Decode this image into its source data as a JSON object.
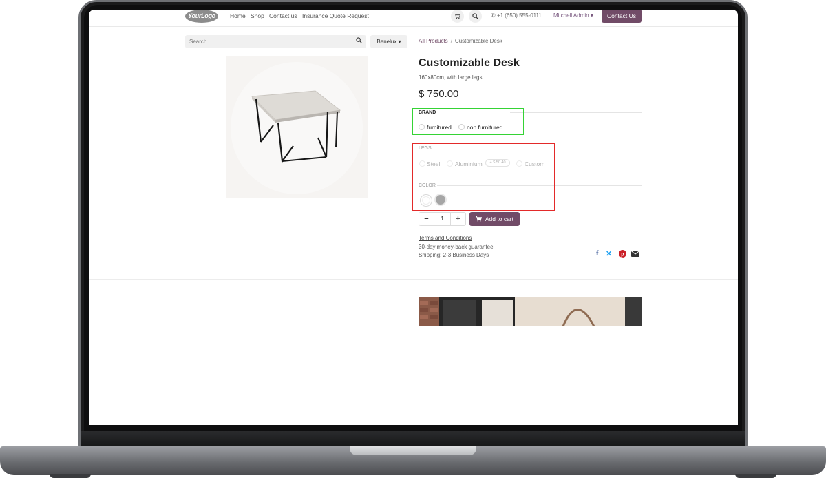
{
  "nav": {
    "logo_text": "YourLogo",
    "links": [
      "Home",
      "Shop",
      "Contact us",
      "Insurance Quote Request"
    ],
    "cart_icon": "cart-icon",
    "search_icon": "search-icon",
    "phone": "+1 (650) 555-0111",
    "user": "Mitchell Admin",
    "contact_button": "Contact Us"
  },
  "search": {
    "placeholder": "Search...",
    "region": "Benelux"
  },
  "breadcrumb": {
    "parent": "All Products",
    "separator": "/",
    "current": "Customizable Desk"
  },
  "product": {
    "name": "Customizable Desk",
    "description": "160x80cm, with large legs.",
    "price": "$ 750.00",
    "attributes": {
      "brand": {
        "label": "BRAND",
        "options": [
          "furnitured",
          "non furnitured"
        ]
      },
      "legs": {
        "label": "LEGS",
        "options": [
          "Steel",
          "Aluminium",
          "Custom"
        ],
        "aluminium_extra": "+ $ 50.40"
      },
      "color": {
        "label": "COLOR",
        "swatches": [
          "#ffffff",
          "#a6a6a6"
        ]
      }
    },
    "quantity": "1",
    "add_to_cart": "Add to cart",
    "terms": "Terms and Conditions",
    "guarantee": "30-day money-back guarantee",
    "shipping": "Shipping: 2-3 Business Days",
    "share_icons": [
      "facebook-icon",
      "x-icon",
      "pinterest-icon",
      "email-icon"
    ]
  },
  "highlight_colors": {
    "brand_box": "#35d335",
    "variant_box": "#e32a2a"
  },
  "accent": "#714b67"
}
